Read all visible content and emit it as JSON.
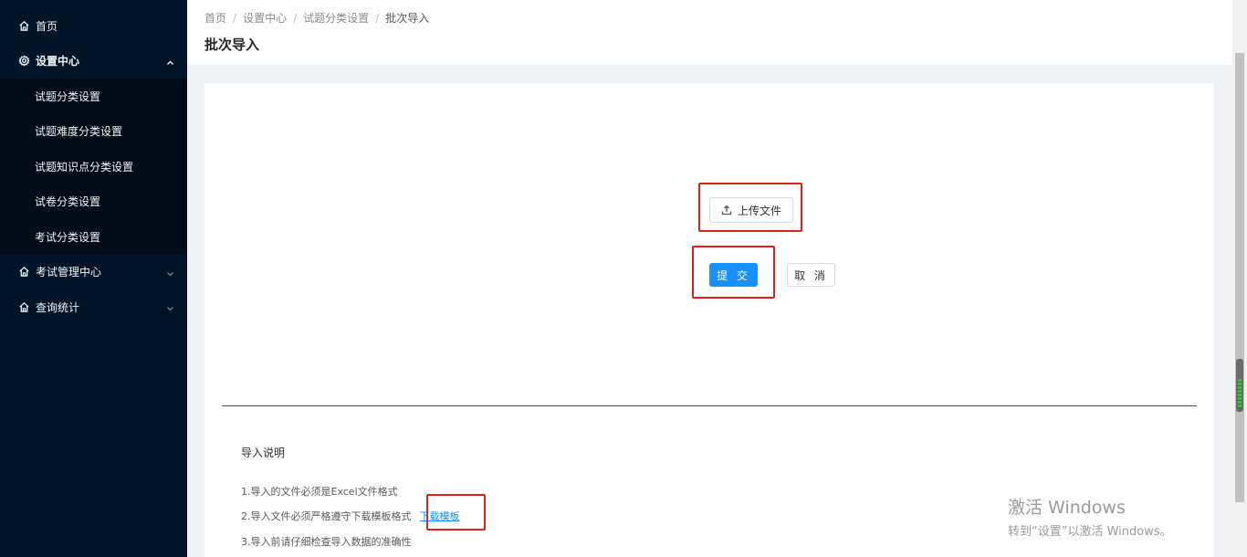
{
  "sidebar": {
    "home": {
      "label": "首页",
      "icon": "home-icon"
    },
    "settings": {
      "label": "设置中心",
      "icon": "gear-icon",
      "expanded": true,
      "items": [
        {
          "label": "试题分类设置"
        },
        {
          "label": "试题难度分类设置"
        },
        {
          "label": "试题知识点分类设置"
        },
        {
          "label": "试卷分类设置"
        },
        {
          "label": "考试分类设置"
        }
      ]
    },
    "exam_mgmt": {
      "label": "考试管理中心",
      "icon": "home-icon",
      "expanded": false
    },
    "stats": {
      "label": "查询统计",
      "icon": "home-icon",
      "expanded": false
    }
  },
  "breadcrumb": {
    "items": [
      "首页",
      "设置中心",
      "试题分类设置",
      "批次导入"
    ],
    "separator": "/"
  },
  "page_title": "批次导入",
  "upload": {
    "label": "上传文件",
    "icon": "upload-icon"
  },
  "actions": {
    "submit_label": "提 交",
    "cancel_label": "取 消"
  },
  "instructions": {
    "title": "导入说明",
    "line1": "1.导入的文件必须是Excel文件格式",
    "line2": "2.导入文件必须严格遵守下载模板格式",
    "download_link": "下载模板",
    "line3": "3.导入前请仔细检查导入数据的准确性"
  },
  "watermark": {
    "line1": "激活 Windows",
    "line2": "转到“设置”以激活 Windows。"
  },
  "colors": {
    "sidebar_bg": "#001529",
    "submenu_bg": "#000c17",
    "primary": "#1890ff",
    "highlight": "#e0201b",
    "page_bg": "#f0f2f5"
  }
}
